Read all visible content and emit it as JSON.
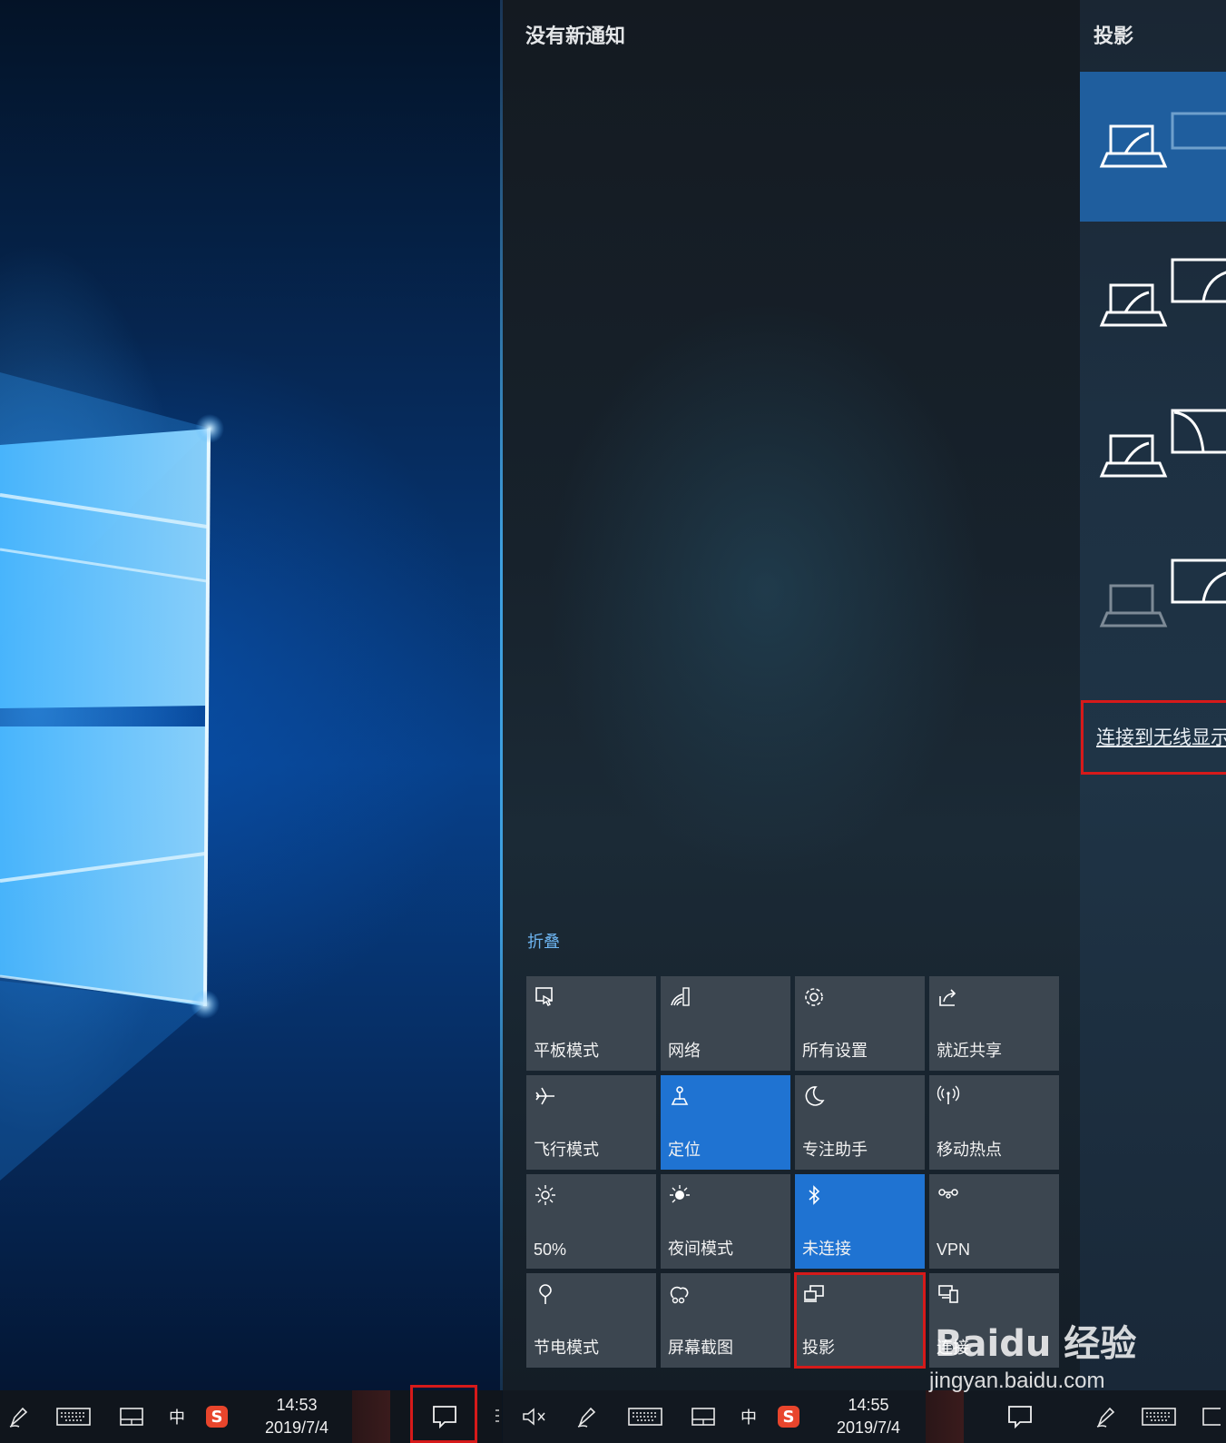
{
  "action_center": {
    "title": "没有新通知",
    "collapse_label": "折叠",
    "tiles": [
      {
        "label": "平板模式",
        "icon": "tablet-mode-icon",
        "active": false
      },
      {
        "label": "网络",
        "icon": "network-icon",
        "active": false
      },
      {
        "label": "所有设置",
        "icon": "gear-icon",
        "active": false
      },
      {
        "label": "就近共享",
        "icon": "share-icon",
        "active": false
      },
      {
        "label": "飞行模式",
        "icon": "airplane-icon",
        "active": false
      },
      {
        "label": "定位",
        "icon": "location-icon",
        "active": true
      },
      {
        "label": "专注助手",
        "icon": "moon-icon",
        "active": false
      },
      {
        "label": "移动热点",
        "icon": "hotspot-icon",
        "active": false
      },
      {
        "label": "50%",
        "icon": "brightness-icon",
        "active": false
      },
      {
        "label": "夜间模式",
        "icon": "night-light-icon",
        "active": false
      },
      {
        "label": "未连接",
        "icon": "bluetooth-icon",
        "active": true
      },
      {
        "label": "VPN",
        "icon": "vpn-icon",
        "active": false
      },
      {
        "label": "节电模式",
        "icon": "battery-saver-icon",
        "active": false
      },
      {
        "label": "屏幕截图",
        "icon": "screen-snip-icon",
        "active": false
      },
      {
        "label": "投影",
        "icon": "project-icon",
        "active": false,
        "highlighted": true
      },
      {
        "label": "连接",
        "icon": "connect-icon",
        "active": false
      }
    ]
  },
  "project_panel": {
    "title": "投影",
    "options": [
      {
        "name": "pc-screen-only",
        "selected": true
      },
      {
        "name": "duplicate",
        "selected": false
      },
      {
        "name": "extend",
        "selected": false
      },
      {
        "name": "second-screen-only",
        "selected": false
      }
    ],
    "wireless_link": "连接到无线显示"
  },
  "taskbar_left": {
    "ime": "中",
    "time": "14:53",
    "date": "2019/7/4"
  },
  "taskbar_mid": {
    "ime": "中",
    "time": "14:55",
    "date": "2019/7/4"
  },
  "watermark": {
    "brand": "Baidu 经验",
    "site": "jingyan.baidu.com"
  },
  "colors": {
    "accent": "#1f73d2",
    "highlight_box": "#d61a1a",
    "tile_bg": "#3c4650"
  }
}
